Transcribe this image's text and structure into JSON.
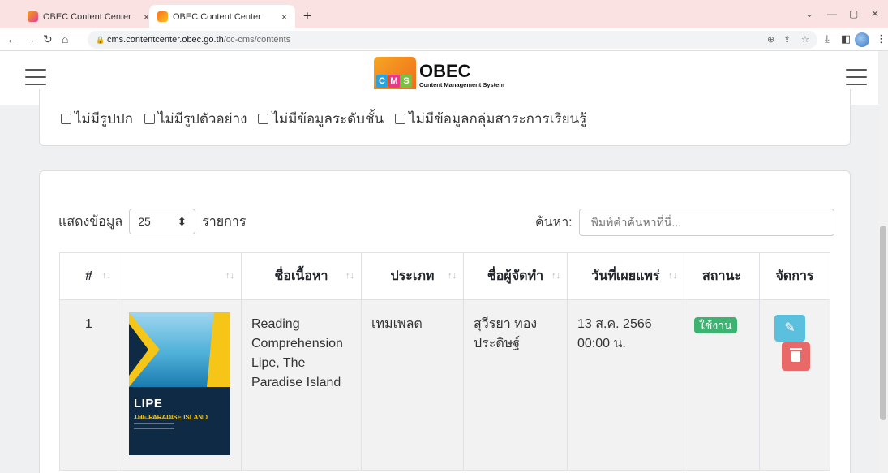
{
  "browser": {
    "tabs": [
      {
        "title": "OBEC Content Center",
        "close": "×"
      },
      {
        "title": "OBEC Content Center",
        "close": "×"
      }
    ],
    "new_tab": "+",
    "url_domain": "cms.contentcenter.obec.go.th",
    "url_path": "/cc-cms/contents"
  },
  "header": {
    "logo_badge": "CMS",
    "logo_title": "OBEC",
    "logo_subtitle": "Content Management System"
  },
  "filters": [
    "ไม่มีรูปปก",
    "ไม่มีรูปตัวอย่าง",
    "ไม่มีข้อมูลระดับชั้น",
    "ไม่มีข้อมูลกลุ่มสาระการเรียนรู้"
  ],
  "table_controls": {
    "show_label": "แสดงข้อมูล",
    "page_size": "25",
    "entries_label": "รายการ",
    "search_label": "ค้นหา:",
    "search_placeholder": "พิมพ์คำค้นหาที่นี่..."
  },
  "table": {
    "columns": [
      "#",
      "",
      "ชื่อเนื้อหา",
      "ประเภท",
      "ชื่อผู้จัดทำ",
      "วันที่เผยแพร่",
      "สถานะ",
      "จัดการ"
    ],
    "rows": [
      {
        "num": "1",
        "cover": {
          "title": "LIPE",
          "subtitle": "THE PARADISE ISLAND"
        },
        "name": "Reading Comprehension Lipe, The Paradise Island",
        "type": "เทมเพลต",
        "author": "สุวีรยา ทอง ประดิษฐ์",
        "date": "13 ส.ค. 2566 00:00 น.",
        "status": "ใช้งาน"
      }
    ]
  },
  "colors": {
    "status_active": "#3cb371",
    "edit_button": "#5bc0de",
    "delete_button": "#e96868"
  }
}
